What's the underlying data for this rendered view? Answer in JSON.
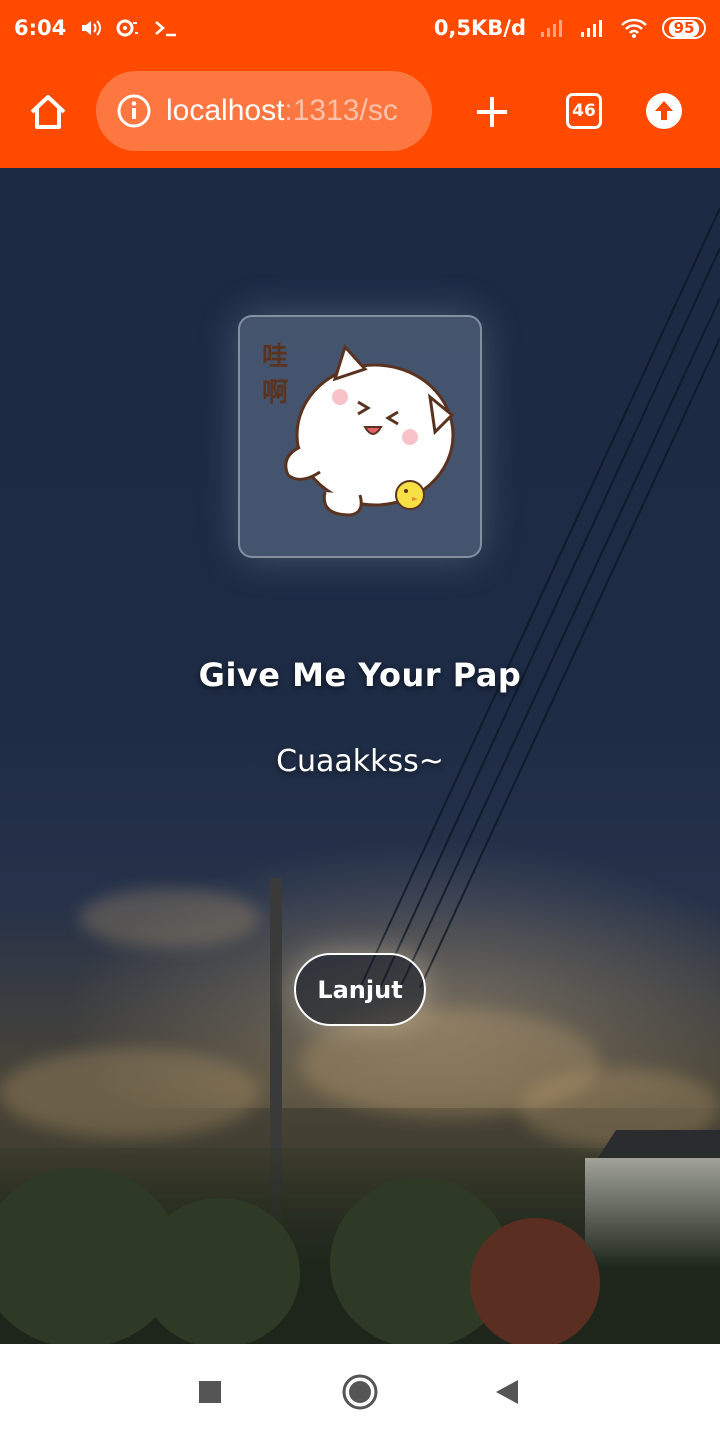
{
  "status_bar": {
    "time": "6:04",
    "network_speed": "0,5KB/d",
    "battery": "95"
  },
  "browser": {
    "url_host": "localhost",
    "url_rest": ":1313/sc",
    "tab_count": "46"
  },
  "page": {
    "title": "Give Me Your Pap",
    "subtitle": "Cuaakkss~",
    "button_label": "Lanjut",
    "sticker_text": "哇啊"
  },
  "colors": {
    "accent": "#ff4a00"
  }
}
